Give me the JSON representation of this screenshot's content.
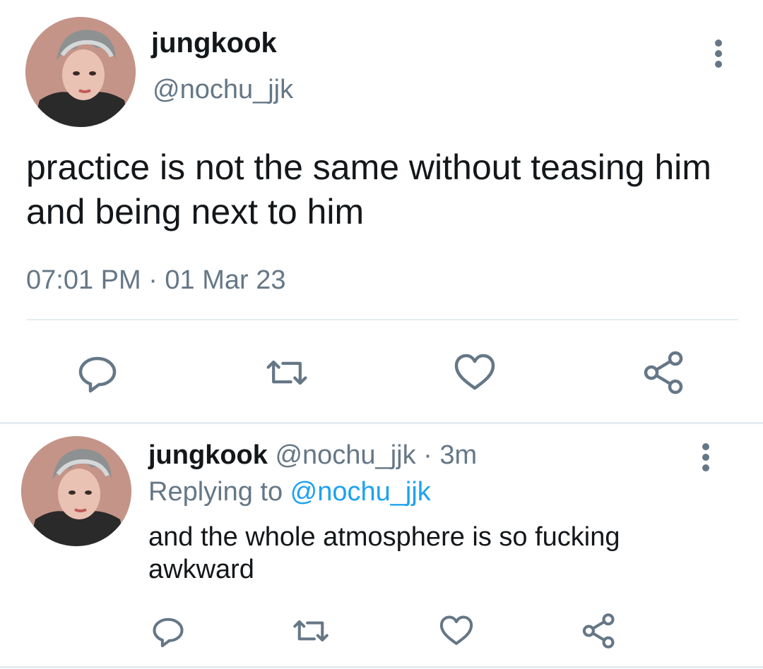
{
  "main_tweet": {
    "display_name": "jungkook",
    "handle": "@nochu_jjk",
    "text": "practice is not the same without teasing him and being next to him",
    "timestamp": "07:01 PM · 01 Mar 23",
    "more_icon": "more-vertical-icon",
    "actions": [
      "reply-icon",
      "retweet-icon",
      "like-icon",
      "share-icon"
    ]
  },
  "reply_tweet": {
    "display_name": "jungkook",
    "meta": " @nochu_jjk · 3m",
    "replying_label": "Replying to ",
    "replying_mention": "@nochu_jjk",
    "text": "and the whole atmosphere is so fucking awkward",
    "more_icon": "more-vertical-icon",
    "actions": [
      "reply-icon",
      "retweet-icon",
      "like-icon",
      "share-icon"
    ]
  },
  "colors": {
    "text": "#14171a",
    "secondary": "#657786",
    "accent": "#1da1f2",
    "divider": "#e6ecf0"
  }
}
